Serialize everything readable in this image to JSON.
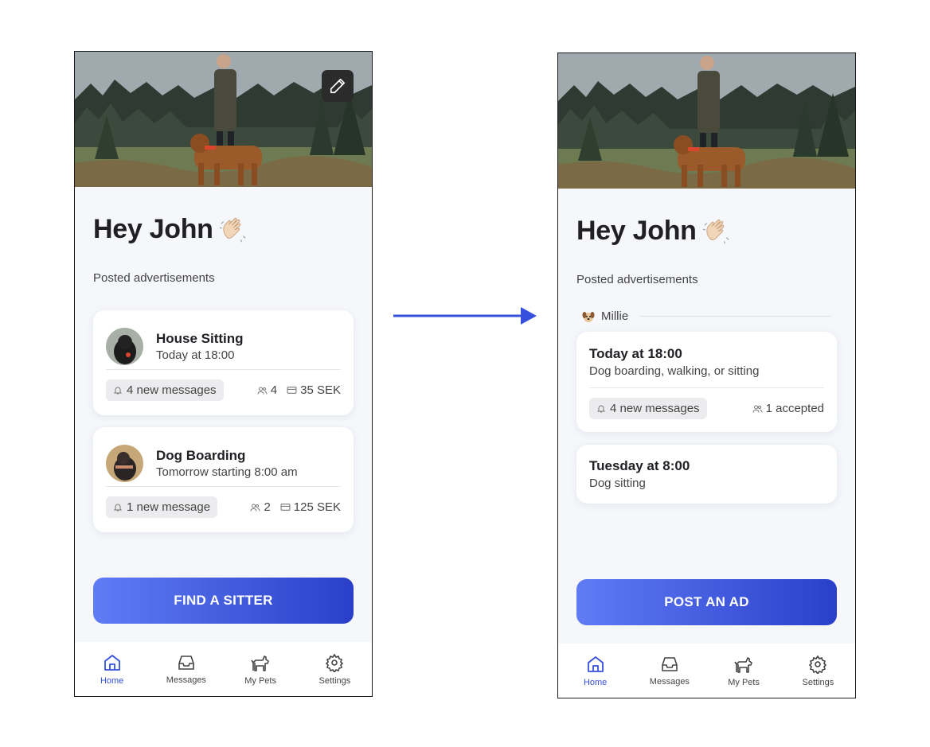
{
  "left": {
    "greeting": "Hey John",
    "section_label": "Posted advertisements",
    "ads": [
      {
        "title": "House Sitting",
        "subtitle": "Today at 18:00",
        "messages": "4 new messages",
        "people": "4",
        "price": "35 SEK"
      },
      {
        "title": "Dog Boarding",
        "subtitle": "Tomorrow starting 8:00 am",
        "messages": "1 new message",
        "people": "2",
        "price": "125 SEK"
      }
    ],
    "cta": "FIND A SITTER",
    "tabs": [
      "Home",
      "Messages",
      "My Pets",
      "Settings"
    ]
  },
  "right": {
    "greeting": "Hey John",
    "section_label": "Posted advertisements",
    "pet_name": "Millie",
    "ads": [
      {
        "title": "Today at 18:00",
        "subtitle": "Dog boarding, walking, or sitting",
        "messages": "4 new messages",
        "accepted": "1 accepted"
      },
      {
        "title": "Tuesday at 8:00",
        "subtitle": "Dog sitting"
      }
    ],
    "cta": "POST AN AD",
    "tabs": [
      "Home",
      "Messages",
      "My Pets",
      "Settings"
    ]
  },
  "colors": {
    "accent": "#3550dc",
    "cta_start": "#5f7cf5",
    "cta_end": "#2a3fc9",
    "arrow": "#3550dc"
  },
  "icons": [
    "edit-icon",
    "wave-emoji-icon",
    "bell-icon",
    "people-icon",
    "card-icon",
    "home-icon",
    "inbox-icon",
    "dog-icon",
    "gear-icon",
    "arrow-right-icon"
  ]
}
